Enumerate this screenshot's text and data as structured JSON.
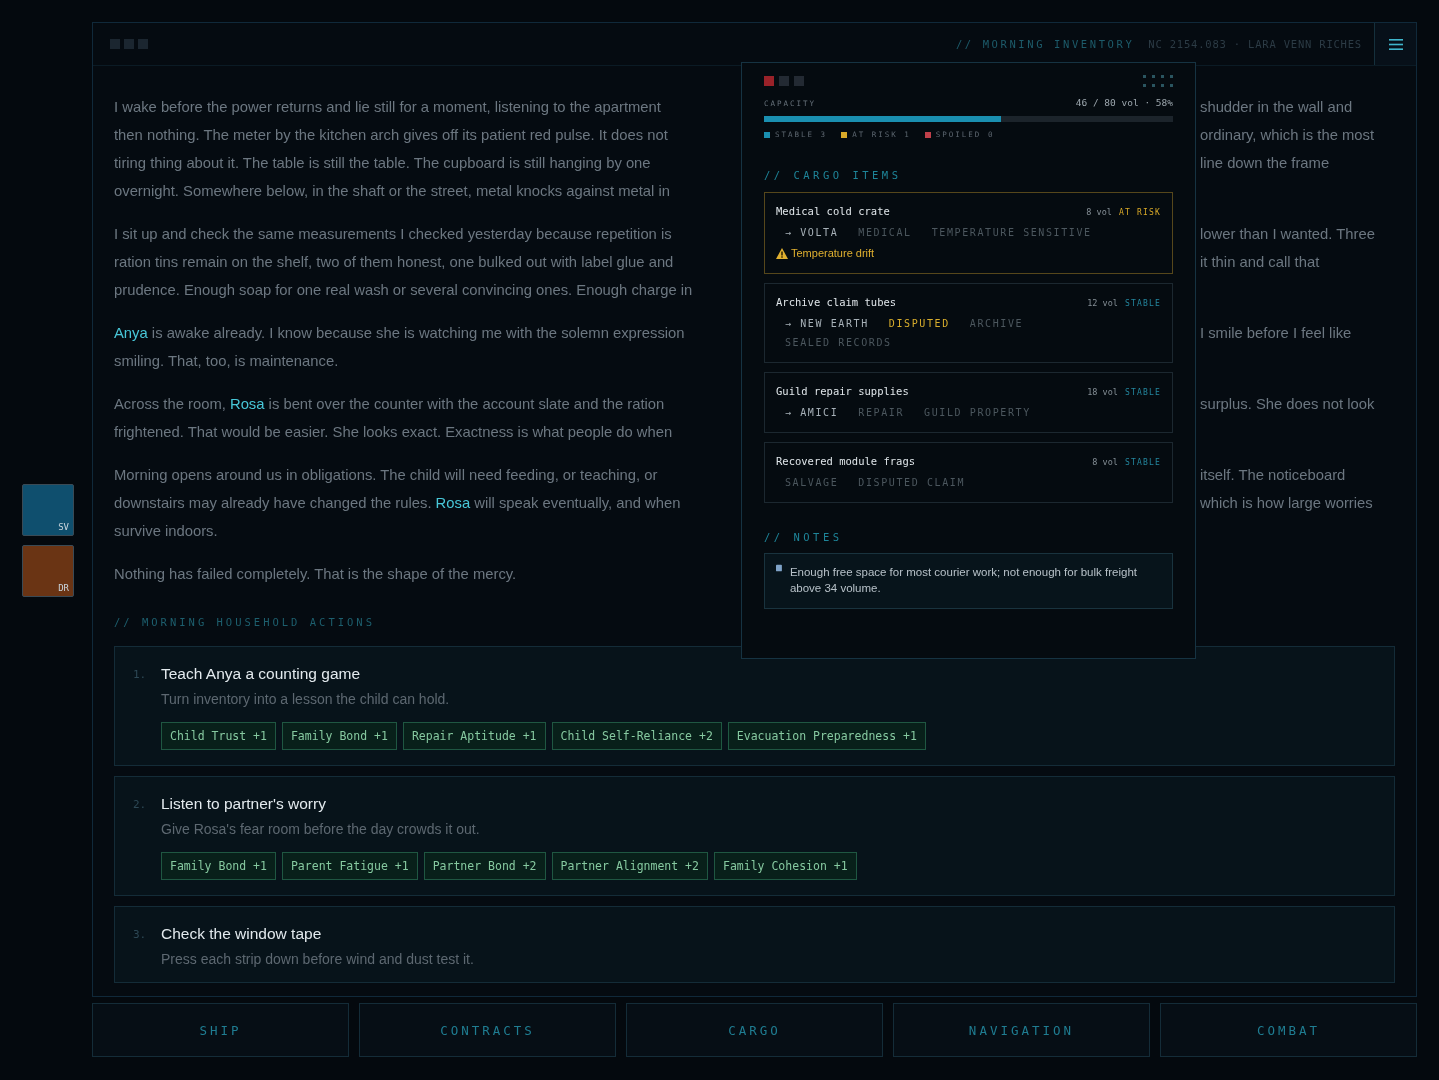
{
  "header": {
    "section": "// MORNING INVENTORY",
    "meta": "NC 2154.083 · LARA VENN RICHES"
  },
  "side_tiles": [
    {
      "label": "SV",
      "color": "#0f4f6e"
    },
    {
      "label": "DR",
      "color": "#6a3414"
    }
  ],
  "story": [
    {
      "lines": [
        {
          "left": [
            {
              "kind": "plain",
              "text": "I wake before the power returns and lie still for a moment, listening to the apartment"
            }
          ],
          "right": "shudder in the wall and"
        },
        {
          "left": [
            {
              "kind": "plain",
              "text": "then nothing. The meter by the kitchen arch gives off its patient red pulse. It does not"
            }
          ],
          "right": "ordinary, which is the most"
        },
        {
          "left": [
            {
              "kind": "plain",
              "text": "tiring thing about it. The table is still the table. The cupboard is still hanging by one"
            }
          ],
          "right": "line down the frame"
        },
        {
          "left": [
            {
              "kind": "plain",
              "text": "overnight. Somewhere below, in the shaft or the street, metal knocks against metal in"
            }
          ]
        }
      ]
    },
    {
      "lines": [
        {
          "left": [
            {
              "kind": "plain",
              "text": "I sit up and check the same measurements I checked yesterday because repetition is"
            }
          ],
          "right": "lower than I wanted. Three"
        },
        {
          "left": [
            {
              "kind": "plain",
              "text": "ration tins remain on the shelf, two of them honest, one bulked out with label glue and"
            }
          ],
          "right": "it thin and call that"
        },
        {
          "left": [
            {
              "kind": "plain",
              "text": "prudence. Enough soap for one real wash or several convincing ones. Enough charge in"
            }
          ]
        }
      ]
    },
    {
      "lines": [
        {
          "left": [
            {
              "kind": "name",
              "text": "Anya"
            },
            {
              "kind": "plain",
              "text": " is awake already. I know because she is watching me with the solemn expression"
            }
          ],
          "right": "I smile before I feel like"
        },
        {
          "left": [
            {
              "kind": "plain",
              "text": "smiling. That, too, is maintenance."
            }
          ]
        }
      ]
    },
    {
      "lines": [
        {
          "left": [
            {
              "kind": "plain",
              "text": "Across the room, "
            },
            {
              "kind": "name",
              "text": "Rosa"
            },
            {
              "kind": "plain",
              "text": " is bent over the counter with the account slate and the ration"
            }
          ],
          "right": "surplus. She does not look"
        },
        {
          "left": [
            {
              "kind": "plain",
              "text": "frightened. That would be easier. She looks exact. Exactness is what people do when"
            }
          ]
        }
      ]
    },
    {
      "lines": [
        {
          "left": [
            {
              "kind": "plain",
              "text": "Morning opens around us in obligations. The child will need feeding, or teaching, or"
            }
          ],
          "right": "itself. The noticeboard"
        },
        {
          "left": [
            {
              "kind": "plain",
              "text": "downstairs may already have changed the rules. "
            },
            {
              "kind": "name",
              "text": "Rosa"
            },
            {
              "kind": "plain",
              "text": " will speak eventually, and when"
            }
          ],
          "right": "which is how large worries"
        },
        {
          "left": [
            {
              "kind": "plain",
              "text": "survive indoors."
            }
          ]
        }
      ]
    },
    {
      "lines": [
        {
          "left": [
            {
              "kind": "plain",
              "text": "Nothing has failed completely. That is the shape of the mercy."
            }
          ]
        }
      ]
    }
  ],
  "actions": {
    "heading": "// MORNING HOUSEHOLD ACTIONS",
    "items": [
      {
        "number": "1.",
        "title": "Teach Anya a counting game",
        "subtitle": "Turn inventory into a lesson the child can hold.",
        "effects": [
          "Child Trust +1",
          "Family Bond +1",
          "Repair Aptitude +1",
          "Child Self-Reliance +2",
          "Evacuation Preparedness +1"
        ]
      },
      {
        "number": "2.",
        "title": "Listen to partner's worry",
        "subtitle": "Give Rosa's fear room before the day crowds it out.",
        "effects": [
          "Family Bond +1",
          "Parent Fatigue +1",
          "Partner Bond +2",
          "Partner Alignment +2",
          "Family Cohesion +1"
        ]
      },
      {
        "number": "3.",
        "title": "Check the window tape",
        "subtitle": "Press each strip down before wind and dust test it."
      }
    ]
  },
  "nav": [
    "SHIP",
    "CONTRACTS",
    "CARGO",
    "NAVIGATION",
    "COMBAT"
  ],
  "cargo_panel": {
    "capacity_label": "CAPACITY",
    "capacity_reading": "46 / 80 vol · 58%",
    "level": 0.58,
    "legend": [
      {
        "label": "STABLE 3",
        "color": "#1a8fb0"
      },
      {
        "label": "AT RISK 1",
        "color": "#d9a928"
      },
      {
        "label": "SPOILED 0",
        "color": "#c0404a"
      }
    ],
    "items_heading": "// CARGO ITEMS",
    "items": [
      {
        "name": "Medical cold crate",
        "volume": "8 vol",
        "status": "AT RISK",
        "kind": "at_risk",
        "tags": [
          {
            "text": "→ VOLTA",
            "kind": "destination"
          },
          {
            "text": "MEDICAL",
            "kind": "plain"
          },
          {
            "text": "TEMPERATURE SENSITIVE",
            "kind": "plain"
          }
        ],
        "alert": "Temperature drift"
      },
      {
        "name": "Archive claim tubes",
        "volume": "12 vol",
        "status": "STABLE",
        "kind": "stable",
        "tags": [
          {
            "text": "→ NEW EARTH",
            "kind": "destination"
          },
          {
            "text": "DISPUTED",
            "kind": "warning"
          },
          {
            "text": "ARCHIVE",
            "kind": "plain"
          },
          {
            "text": "SEALED RECORDS",
            "kind": "plain"
          }
        ]
      },
      {
        "name": "Guild repair supplies",
        "volume": "18 vol",
        "status": "STABLE",
        "kind": "stable",
        "tags": [
          {
            "text": "→ AMICI",
            "kind": "destination"
          },
          {
            "text": "REPAIR",
            "kind": "plain"
          },
          {
            "text": "GUILD PROPERTY",
            "kind": "plain"
          }
        ]
      },
      {
        "name": "Recovered module frags",
        "volume": "8 vol",
        "status": "STABLE",
        "kind": "stable",
        "tags": [
          {
            "text": "SALVAGE",
            "kind": "plain"
          },
          {
            "text": "DISPUTED CLAIM",
            "kind": "plain"
          }
        ]
      }
    ],
    "notes_heading": "// NOTES",
    "note": "Enough free space for most courier work; not enough for bulk freight above 34 volume."
  }
}
